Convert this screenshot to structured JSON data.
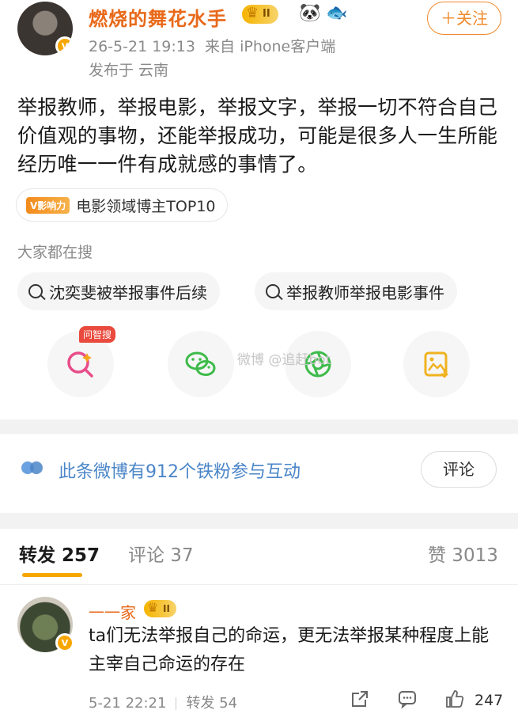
{
  "post": {
    "username": "燃烧的舞花水手",
    "level_badge": "II",
    "timestamp": "26-5-21 19:13",
    "source": "来自 iPhone客户端",
    "location": "发布于 云南",
    "follow_label": "＋关注",
    "content": "举报教师，举报电影，举报文字，举报一切不符合自己价值观的事物，还能举报成功，可能是很多人一生所能经历唯一一件有成就感的事情了。",
    "tag_badge": "V影响力",
    "tag_text": "电影领域博主TOP10"
  },
  "search": {
    "title": "大家都在搜",
    "items": [
      "沈奕斐被举报事件后续",
      "举报教师举报电影事件"
    ]
  },
  "share": {
    "tip": "问智搜",
    "watermark": "微博 @追赶bot"
  },
  "fans": {
    "text": "此条微博有912个铁粉参与互动",
    "button": "评论"
  },
  "tabs": {
    "repost": "转发 257",
    "comment": "评论 37",
    "like": "赞 3013"
  },
  "comment": {
    "name": "一一家",
    "level_badge": "II",
    "text": "ta们无法举报自己的命运，更无法举报某种程度上能主宰自己命运的存在",
    "time": "5-21 22:21",
    "repost": "转发 54",
    "likes": "247"
  },
  "colors": {
    "brand_orange": "#f08a2b",
    "link_blue": "#4b86c8",
    "tab_indicator": "#f7a600"
  }
}
